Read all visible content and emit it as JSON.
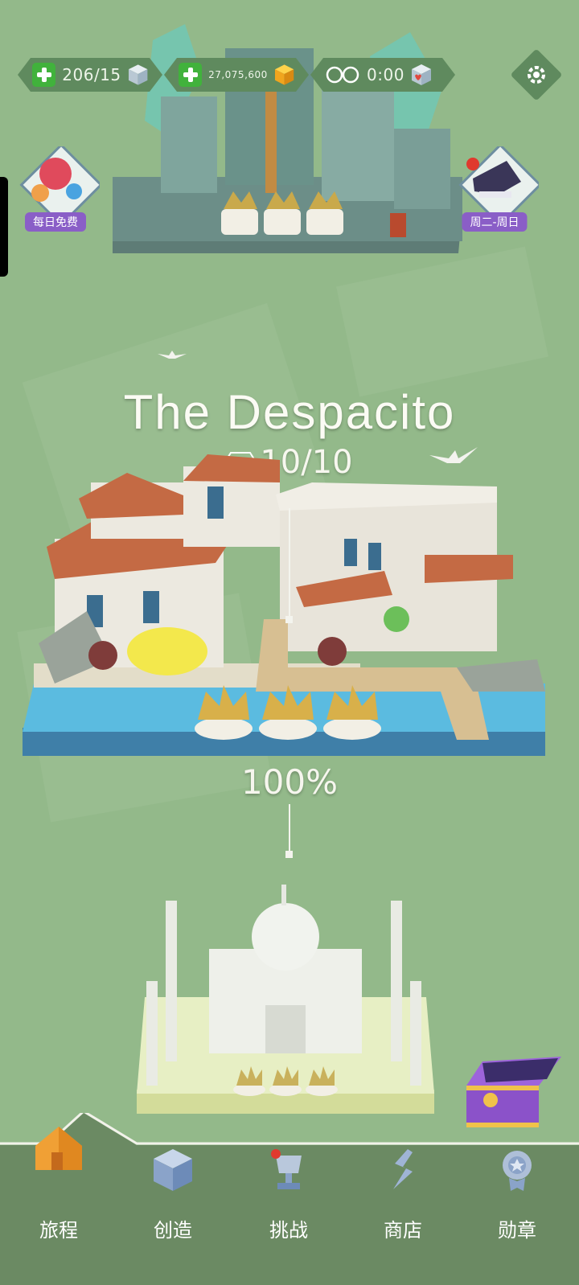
{
  "hud": {
    "lives": "206/15",
    "coins": "27,075,600",
    "timer": "0:00"
  },
  "side_buttons": {
    "daily_free": "每日免费",
    "weekend": "周二-周日"
  },
  "level": {
    "title": "The Despacito",
    "gems": "10/10",
    "progress": "100%"
  },
  "tabs": [
    {
      "label": "旅程",
      "icon": "house-icon"
    },
    {
      "label": "创造",
      "icon": "cube-icon"
    },
    {
      "label": "挑战",
      "icon": "trophy-icon"
    },
    {
      "label": "商店",
      "icon": "shop-icon"
    },
    {
      "label": "勋章",
      "icon": "medal-icon"
    }
  ],
  "colors": {
    "background": "#93b98a",
    "hud": "#5f8a5e",
    "tabbar": "#6b8a63",
    "accent_green": "#41b23c",
    "purple": "#8a5ec7"
  }
}
